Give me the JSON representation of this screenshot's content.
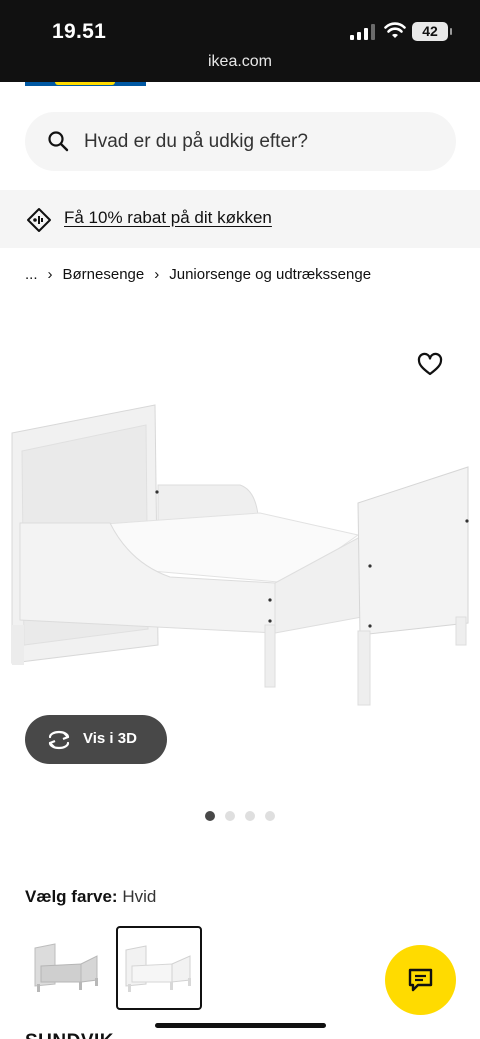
{
  "status_bar": {
    "time": "19.51",
    "url": "ikea.com",
    "battery": "42"
  },
  "search": {
    "placeholder": "Hvad er du på udkig efter?"
  },
  "promo": {
    "text": "Få 10% rabat på dit køkken"
  },
  "breadcrumb": {
    "items": [
      "...",
      "Børnesenge",
      "Juniorsenge og udtrækssenge"
    ]
  },
  "actions": {
    "vis_3d": "Vis i 3D"
  },
  "gallery": {
    "total_images": 4,
    "active_index": 0
  },
  "color": {
    "label": "Vælg farve:",
    "value": "Hvid"
  },
  "product": {
    "title_partial": "SUNDVIK"
  },
  "icons": {
    "search": "search-icon",
    "promo": "tag-icon",
    "favourite": "heart-icon",
    "rotate": "rotate-3d-icon",
    "chat": "chat-icon"
  },
  "colors": {
    "accent_yellow": "#ffdb00",
    "ikea_blue": "#0058a3",
    "button_dark": "#484848"
  }
}
